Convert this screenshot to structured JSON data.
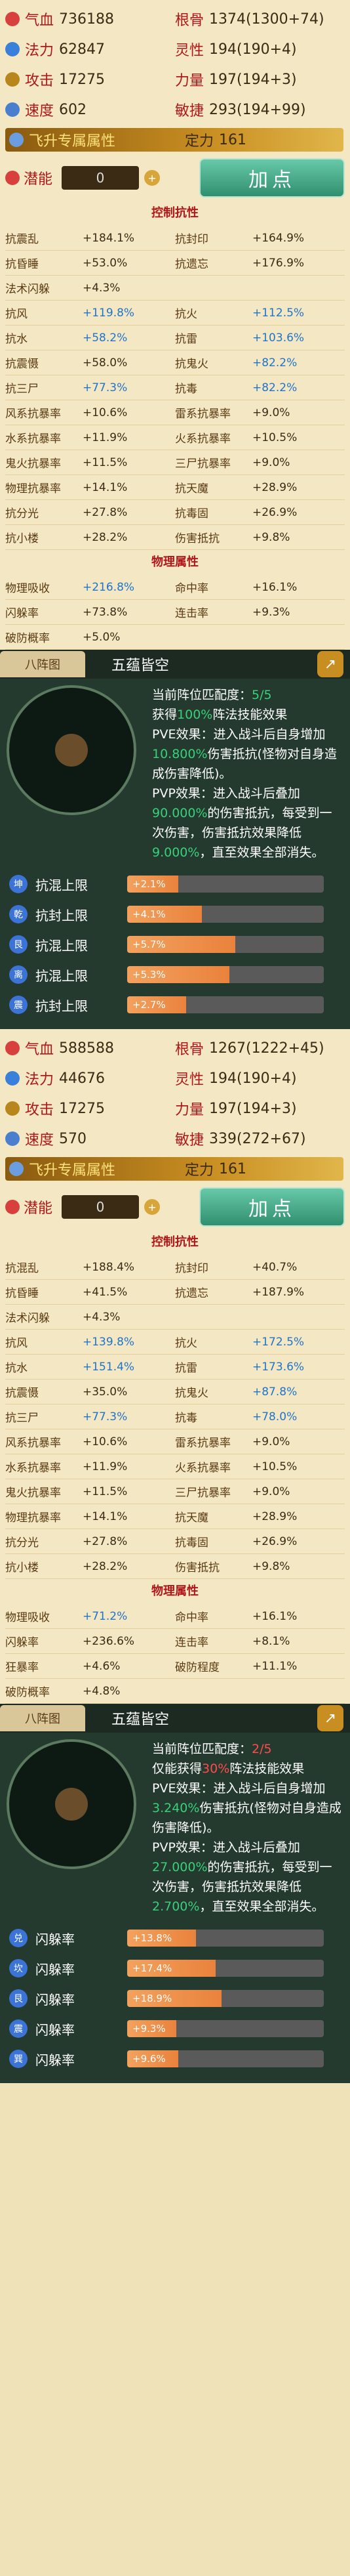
{
  "panel1": {
    "stats": [
      [
        "气血",
        "736188",
        "根骨",
        "1374(1300+74)"
      ],
      [
        "法力",
        "62847",
        "灵性",
        "194(190+4)"
      ],
      [
        "攻击",
        "17275",
        "力量",
        "197(194+3)"
      ],
      [
        "速度",
        "602",
        "敏捷",
        "293(194+99)"
      ]
    ],
    "special": {
      "label": "飞升专属属性",
      "right_label": "定力",
      "right_val": "161"
    },
    "potential": {
      "label": "潜能",
      "value": "0",
      "add": "加点"
    },
    "resist_title": "控制抗性",
    "resist": [
      [
        "抗震乱",
        "+184.1%",
        "抗封印",
        "+164.9%"
      ],
      [
        "抗昏睡",
        "+53.0%",
        "抗遗忘",
        "+176.9%"
      ],
      [
        "法术闪躲",
        "+4.3%",
        "",
        ""
      ],
      [
        "抗风",
        "+119.8%",
        "抗火",
        "+112.5%"
      ],
      [
        "抗水",
        "+58.2%",
        "抗雷",
        "+103.6%"
      ],
      [
        "抗震慑",
        "+58.0%",
        "抗鬼火",
        "+82.2%"
      ],
      [
        "抗三尸",
        "+77.3%",
        "抗毒",
        "+82.2%"
      ],
      [
        "风系抗暴率",
        "+10.6%",
        "雷系抗暴率",
        "+9.0%"
      ],
      [
        "水系抗暴率",
        "+11.9%",
        "火系抗暴率",
        "+10.5%"
      ],
      [
        "鬼火抗暴率",
        "+11.5%",
        "三尸抗暴率",
        "+9.0%"
      ],
      [
        "物理抗暴率",
        "+14.1%",
        "抗天魔",
        "+28.9%"
      ],
      [
        "抗分光",
        "+27.8%",
        "抗毒固",
        "+26.9%"
      ],
      [
        "抗小楼",
        "+28.2%",
        "伤害抵抗",
        "+9.8%"
      ]
    ],
    "phys_title": "物理属性",
    "phys": [
      [
        "物理吸收",
        "+216.8%",
        "命中率",
        "+16.1%"
      ],
      [
        "闪躲率",
        "+73.8%",
        "连击率",
        "+9.3%"
      ],
      [
        "破防概率",
        "+5.0%",
        "",
        ""
      ]
    ]
  },
  "zhen1": {
    "tab": "八阵图",
    "title": "五蕴皆空",
    "line1": "当前阵位匹配度：",
    "match": "5/5",
    "line2a": "获得",
    "pct": "100%",
    "line2b": "阵法技能效果",
    "pve": "PVE效果：进入战斗后自身增加",
    "pve_val": "10.800%",
    "pve_tail": "伤害抵抗(怪物对自身造成伤害降低)。",
    "pvp": "PVP效果：进入战斗后叠加",
    "pvp_val": "90.000%",
    "pvp_tail": "的伤害抵抗，每受到一次伤害，伤害抵抗效果降低",
    "pvp_val2": "9.000%",
    "pvp_tail2": "，直至效果全部消失。",
    "rows": [
      {
        "b": "坤",
        "label": "抗混上限",
        "val": "+2.1%",
        "fill": 0.26
      },
      {
        "b": "乾",
        "label": "抗封上限",
        "val": "+4.1%",
        "fill": 0.38
      },
      {
        "b": "艮",
        "label": "抗混上限",
        "val": "+5.7%",
        "fill": 0.55
      },
      {
        "b": "离",
        "label": "抗混上限",
        "val": "+5.3%",
        "fill": 0.52
      },
      {
        "b": "震",
        "label": "抗封上限",
        "val": "+2.7%",
        "fill": 0.3
      }
    ]
  },
  "panel2": {
    "stats": [
      [
        "气血",
        "588588",
        "根骨",
        "1267(1222+45)"
      ],
      [
        "法力",
        "44676",
        "灵性",
        "194(190+4)"
      ],
      [
        "攻击",
        "17275",
        "力量",
        "197(194+3)"
      ],
      [
        "速度",
        "570",
        "敏捷",
        "339(272+67)"
      ]
    ],
    "special": {
      "label": "飞升专属属性",
      "right_label": "定力",
      "right_val": "161"
    },
    "potential": {
      "label": "潜能",
      "value": "0",
      "add": "加点"
    },
    "resist_title": "控制抗性",
    "resist": [
      [
        "抗混乱",
        "+188.4%",
        "抗封印",
        "+40.7%"
      ],
      [
        "抗昏睡",
        "+41.5%",
        "抗遗忘",
        "+187.9%"
      ],
      [
        "法术闪躲",
        "+4.3%",
        "",
        ""
      ],
      [
        "抗风",
        "+139.8%",
        "抗火",
        "+172.5%"
      ],
      [
        "抗水",
        "+151.4%",
        "抗雷",
        "+173.6%"
      ],
      [
        "抗震慑",
        "+35.0%",
        "抗鬼火",
        "+87.8%"
      ],
      [
        "抗三尸",
        "+77.3%",
        "抗毒",
        "+78.0%"
      ],
      [
        "风系抗暴率",
        "+10.6%",
        "雷系抗暴率",
        "+9.0%"
      ],
      [
        "水系抗暴率",
        "+11.9%",
        "火系抗暴率",
        "+10.5%"
      ],
      [
        "鬼火抗暴率",
        "+11.5%",
        "三尸抗暴率",
        "+9.0%"
      ],
      [
        "物理抗暴率",
        "+14.1%",
        "抗天魔",
        "+28.9%"
      ],
      [
        "抗分光",
        "+27.8%",
        "抗毒固",
        "+26.9%"
      ],
      [
        "抗小楼",
        "+28.2%",
        "伤害抵抗",
        "+9.8%"
      ]
    ],
    "phys_title": "物理属性",
    "phys": [
      [
        "物理吸收",
        "+71.2%",
        "命中率",
        "+16.1%"
      ],
      [
        "闪躲率",
        "+236.6%",
        "连击率",
        "+8.1%"
      ],
      [
        "狂暴率",
        "+4.6%",
        "破防程度",
        "+11.1%"
      ],
      [
        "破防概率",
        "+4.8%",
        "",
        ""
      ]
    ]
  },
  "zhen2": {
    "tab": "八阵图",
    "title": "五蕴皆空",
    "line1": "当前阵位匹配度：",
    "match": "2/5",
    "line2a": "仅能获得",
    "pct": "30%",
    "line2b": "阵法技能效果",
    "pve": "PVE效果：进入战斗后自身增加",
    "pve_val": "3.240%",
    "pve_tail": "伤害抵抗(怪物对自身造成伤害降低)。",
    "pvp": "PVP效果：进入战斗后叠加",
    "pvp_val": "27.000%",
    "pvp_tail": "的伤害抵抗，每受到一次伤害，伤害抵抗效果降低",
    "pvp_val2": "2.700%",
    "pvp_tail2": "，直至效果全部消失。",
    "rows": [
      {
        "b": "兑",
        "label": "闪躲率",
        "val": "+13.8%",
        "fill": 0.35
      },
      {
        "b": "坎",
        "label": "闪躲率",
        "val": "+17.4%",
        "fill": 0.45
      },
      {
        "b": "艮",
        "label": "闪躲率",
        "val": "+18.9%",
        "fill": 0.48
      },
      {
        "b": "震",
        "label": "闪躲率",
        "val": "+9.3%",
        "fill": 0.25
      },
      {
        "b": "巽",
        "label": "闪躲率",
        "val": "+9.6%",
        "fill": 0.26
      }
    ]
  },
  "colors": {
    "red": "#b0171a",
    "blue": "#1f74c9",
    "green": "#39d07a"
  },
  "icons": [
    "blood-icon",
    "mana-icon",
    "sword-icon",
    "speed-icon",
    "wing-icon",
    "potential-icon"
  ]
}
